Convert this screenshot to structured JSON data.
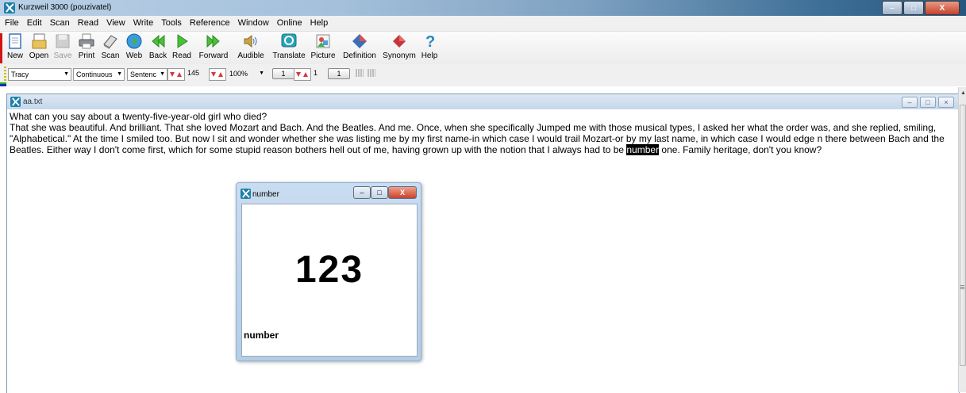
{
  "window": {
    "title": "Kurzweil 3000 (pouzivatel)"
  },
  "menu": [
    "File",
    "Edit",
    "Scan",
    "Read",
    "View",
    "Write",
    "Tools",
    "Reference",
    "Window",
    "Online",
    "Help"
  ],
  "toolbar": [
    {
      "label": "New",
      "icon": "new-icon",
      "enabled": true
    },
    {
      "label": "Open",
      "icon": "open-icon",
      "enabled": true
    },
    {
      "label": "Save",
      "icon": "save-icon",
      "enabled": false
    },
    {
      "label": "Print",
      "icon": "print-icon",
      "enabled": true
    },
    {
      "label": "Scan",
      "icon": "scan-icon",
      "enabled": true
    },
    {
      "label": "Web",
      "icon": "web-icon",
      "enabled": true
    },
    {
      "label": "Back",
      "icon": "back-icon",
      "enabled": true
    },
    {
      "label": "Read",
      "icon": "read-icon",
      "enabled": true
    },
    {
      "label": "Forward",
      "icon": "forward-icon",
      "enabled": true
    },
    {
      "label": "Audible",
      "icon": "audible-icon",
      "enabled": true
    },
    {
      "label": "Translate",
      "icon": "translate-icon",
      "enabled": true
    },
    {
      "label": "Picture",
      "icon": "picture-icon",
      "enabled": true
    },
    {
      "label": "Definition",
      "icon": "definition-icon",
      "enabled": true
    },
    {
      "label": "Synonym",
      "icon": "synonym-icon",
      "enabled": true
    },
    {
      "label": "Help",
      "icon": "help-icon",
      "enabled": true
    }
  ],
  "options": {
    "voice": "Tracy",
    "mode": "Continuous",
    "unit": "Sentenc",
    "speed": "145",
    "zoom": "100%",
    "box1": "1",
    "spin_value": "1",
    "box2": "1"
  },
  "document": {
    "name": "aa.txt",
    "line1": "What can you say about a twenty-five-year-old girl who died?",
    "para_before": "That she was beautiful. And brilliant. That she loved Mozart and Bach. And the Beatles. And me. Once, when she specifically Jumped me with those musical types, I asked her what the order was, and she replied, smiling, \"Alphabetical.\" At the time I smiled too. But now I sit and wonder whether she was listing me by my first name-in which case I would trail Mozart-or by my last name, in which case I would edge n there between Bach and the Beatles. Either way I don't come first, which for some stupid reason bothers hell out of me, having grown up with the notion that I always had to be ",
    "highlight": "number",
    "para_after": " one. Family heritage, don't you know?"
  },
  "popup": {
    "title": "number",
    "big_text": "123",
    "word": "number"
  },
  "colors": {
    "accent_red": "#d01515",
    "highlight_bg": "#000000"
  }
}
